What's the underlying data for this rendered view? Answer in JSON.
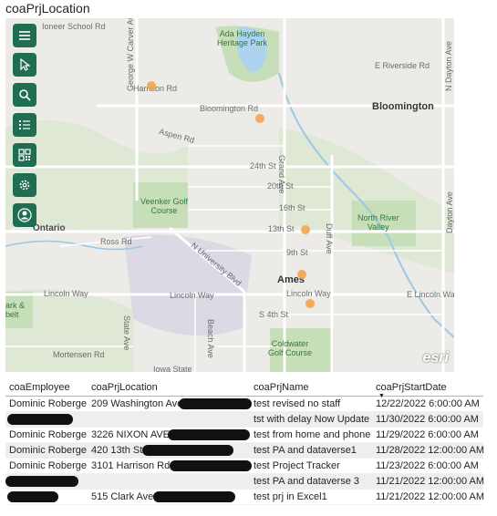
{
  "title": "coaPrjLocation",
  "map": {
    "labels": {
      "school": "Ioneer School Rd",
      "george_w": "George W Carver Ave",
      "park": "Ada Hayden\nHeritage Park",
      "riverside": "E Riverside Rd",
      "dayton_top": "N Dayton Ave",
      "harrison": "Harrison Rd",
      "bloomington_rd": "Bloomington Rd",
      "bloomington": "Bloomington",
      "aspen": "Aspen Rd",
      "grand": "Grand Ave",
      "st24": "24th St",
      "st20": "20th St",
      "st16": "16th St",
      "st13": "13th St",
      "st9": "9th St",
      "veenker": "Veenker Golf\nCourse",
      "north_river": "North River\nValley",
      "ontario": "Ontario",
      "ross": "Ross Rd",
      "n_university": "N University Blvd",
      "duff": "Duff Ave",
      "ames": "Ames",
      "dayton_bottom": "Dayton Ave",
      "lincoln_left": "Lincoln Way",
      "lincoln_mid": "Lincoln Way",
      "lincoln_right": "Lincoln Way",
      "e_lincoln": "E Lincoln Way",
      "ark": "ark &\nbelt",
      "s4th": "S 4th St",
      "state": "State Ave",
      "beach": "Beach Ave",
      "coldwater": "Coldwater\nGolf Course",
      "mortensen": "Mortensen Rd",
      "iowa": "Iowa State",
      "esri": "esri"
    },
    "toolbar": [
      {
        "icon": "menu-icon"
      },
      {
        "icon": "cursor-icon"
      },
      {
        "icon": "search-icon"
      },
      {
        "icon": "list-icon"
      },
      {
        "icon": "qr-icon"
      },
      {
        "icon": "gear-icon"
      },
      {
        "icon": "user-icon"
      }
    ],
    "point_color": "#f5a54a"
  },
  "table": {
    "headers": [
      "coaEmployee",
      "coaPrjLocation",
      "coaPrjName",
      "coaPrjStartDate"
    ],
    "sort_indicator": "▼",
    "rows": [
      {
        "employee": "Dominic Roberge",
        "location": "209 Washington Ave,",
        "name": "test revised no staff",
        "date": "12/22/2022 6:00:00 AM"
      },
      {
        "employee": "",
        "location": "",
        "name": "tst with delay Now Update",
        "date": "11/30/2022 6:00:00 AM"
      },
      {
        "employee": "Dominic Roberge",
        "location": "3226 NIXON AVE,",
        "name": "test from home and phone",
        "date": "11/29/2022 6:00:00 AM"
      },
      {
        "employee": "Dominic Roberge",
        "location": "420 13th St",
        "name": "test PA and dataverse1",
        "date": "11/28/2022 12:00:00 AM"
      },
      {
        "employee": "Dominic Roberge",
        "location": "3101 Harrison Rd,",
        "name": "test Project Tracker",
        "date": "11/23/2022 6:00:00 AM"
      },
      {
        "employee": "",
        "location": "",
        "name": "test PA and dataverse 3",
        "date": "11/21/2022 12:00:00 AM"
      },
      {
        "employee": "",
        "location": "515 Clark Ave,",
        "name": "test prj in Excel1",
        "date": "11/21/2022 12:00:00 AM"
      }
    ]
  }
}
